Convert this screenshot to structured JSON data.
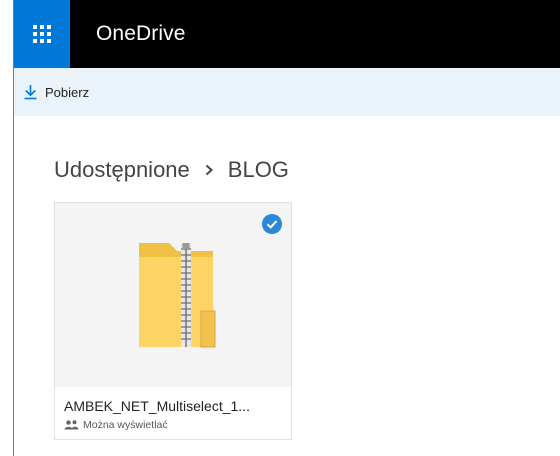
{
  "header": {
    "brand": "OneDrive",
    "launcher_icon": "app-launcher-grid-icon",
    "launcher_color": "#0078d7",
    "background": "#000000"
  },
  "commandbar": {
    "download_label": "Pobierz",
    "download_icon": "download-arrow-icon",
    "background": "#eaf3fa",
    "accent": "#0078d7"
  },
  "breadcrumb": {
    "items": [
      "Udostępnione",
      "BLOG"
    ],
    "separator_icon": "chevron-right-icon"
  },
  "files": [
    {
      "name": "AMBEK_NET_Multiselect_1...",
      "sharing": "Można wyświetlać",
      "type_icon": "zip-folder-icon",
      "selected": true,
      "selected_icon": "checkmark-circle-icon",
      "sharing_icon": "people-icon"
    }
  ]
}
